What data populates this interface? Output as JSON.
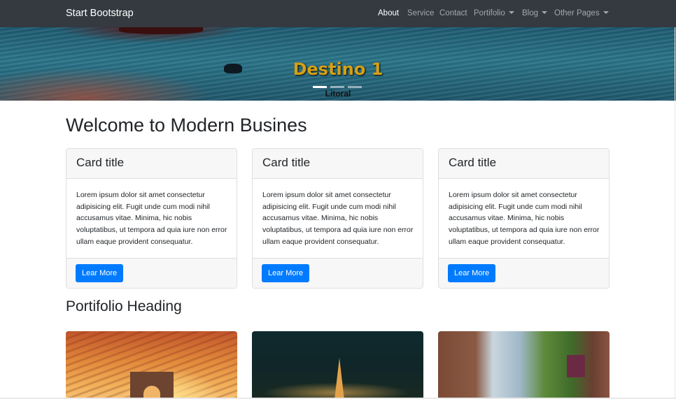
{
  "navbar": {
    "brand": "Start Bootstrap",
    "links": [
      {
        "label": "About",
        "active": true,
        "dropdown": false
      },
      {
        "label": "Service",
        "active": false,
        "dropdown": false
      },
      {
        "label": "Contact",
        "active": false,
        "dropdown": false
      },
      {
        "label": "Portifolio",
        "active": false,
        "dropdown": true
      },
      {
        "label": "Blog",
        "active": false,
        "dropdown": true
      },
      {
        "label": "Other Pages",
        "active": false,
        "dropdown": true
      }
    ]
  },
  "carousel": {
    "title": "Destino 1",
    "subtitle": "Litoral",
    "indicators": 3,
    "active_index": 0
  },
  "main": {
    "heading": "Welcome to Modern Busines",
    "cards": [
      {
        "title": "Card title",
        "text": "Lorem ipsum dolor sit amet consectetur adipisicing elit. Fugit unde cum modi nihil accusamus vitae. Minima, hic nobis voluptatibus, ut tempora ad quia iure non error ullam eaque provident consequatur.",
        "button": "Lear More"
      },
      {
        "title": "Card title",
        "text": "Lorem ipsum dolor sit amet consectetur adipisicing elit. Fugit unde cum modi nihil accusamus vitae. Minima, hic nobis voluptatibus, ut tempora ad quia iure non error ullam eaque provident consequatur.",
        "button": "Lear More"
      },
      {
        "title": "Card title",
        "text": "Lorem ipsum dolor sit amet consectetur adipisicing elit. Fugit unde cum modi nihil accusamus vitae. Minima, hic nobis voluptatibus, ut tempora ad quia iure non error ullam eaque provident consequatur.",
        "button": "Lear More"
      }
    ],
    "portfolio_heading": "Portifolio Heading",
    "portfolio_images": [
      "arc-de-triomphe-sunset-image",
      "eiffel-tower-night-image",
      "village-street-image"
    ]
  },
  "colors": {
    "navbar_bg": "#343a40",
    "primary": "#007bff",
    "slide_title": "#d4a017"
  }
}
